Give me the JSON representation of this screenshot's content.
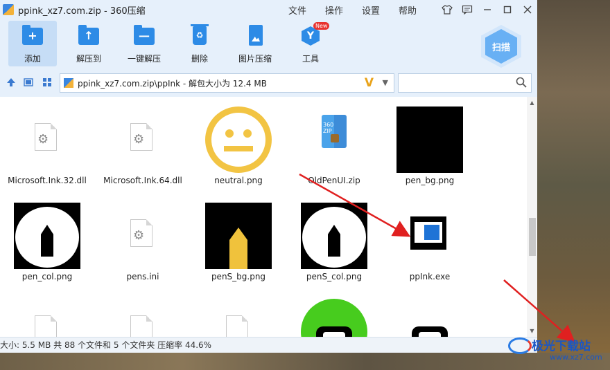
{
  "window": {
    "title": "ppink_xz7.com.zip - 360压缩",
    "menu": [
      "文件",
      "操作",
      "设置",
      "帮助"
    ]
  },
  "toolbar": {
    "buttons": [
      {
        "label": "添加",
        "icon": "add-folder-icon",
        "active": true
      },
      {
        "label": "解压到",
        "icon": "extract-to-icon"
      },
      {
        "label": "一键解压",
        "icon": "one-click-extract-icon"
      },
      {
        "label": "删除",
        "icon": "delete-bin-icon"
      },
      {
        "label": "图片压缩",
        "icon": "image-compress-icon"
      },
      {
        "label": "工具",
        "icon": "tools-hexagon-icon",
        "badge": "New"
      }
    ],
    "scan_label": "扫描"
  },
  "address": {
    "path": "ppink_xz7.com.zip\\ppInk - 解包大小为 12.4 MB",
    "badge": "V",
    "search_placeholder": ""
  },
  "files": [
    {
      "name": "Microsoft.Ink.32.dll",
      "kind": "dll"
    },
    {
      "name": "Microsoft.Ink.64.dll",
      "kind": "dll"
    },
    {
      "name": "neutral.png",
      "kind": "smiley"
    },
    {
      "name": "OldPenUI.zip",
      "kind": "zip"
    },
    {
      "name": "pen_bg.png",
      "kind": "black"
    },
    {
      "name": "pen_col.png",
      "kind": "pen"
    },
    {
      "name": "pens.ini",
      "kind": "ini"
    },
    {
      "name": "penS_bg.png",
      "kind": "crayon"
    },
    {
      "name": "penS_col.png",
      "kind": "pen"
    },
    {
      "name": "ppInk.exe",
      "kind": "exe"
    },
    {
      "name": "",
      "kind": "doc"
    },
    {
      "name": "",
      "kind": "doc"
    },
    {
      "name": "",
      "kind": "doc"
    },
    {
      "name": "",
      "kind": "green"
    },
    {
      "name": "",
      "kind": "pill"
    }
  ],
  "zip_icon_label": "360\nZIP",
  "status": "大小: 5.5 MB 共 88 个文件和 5 个文件夹 压缩率 44.6%",
  "watermark": {
    "title": "极光下载站",
    "sub": "www.xz7.com"
  },
  "colors": {
    "accent": "#2d8be6",
    "toolbar_bg": "#e6f0fb",
    "arrow": "#e02020",
    "v_badge": "#e9a31b"
  }
}
